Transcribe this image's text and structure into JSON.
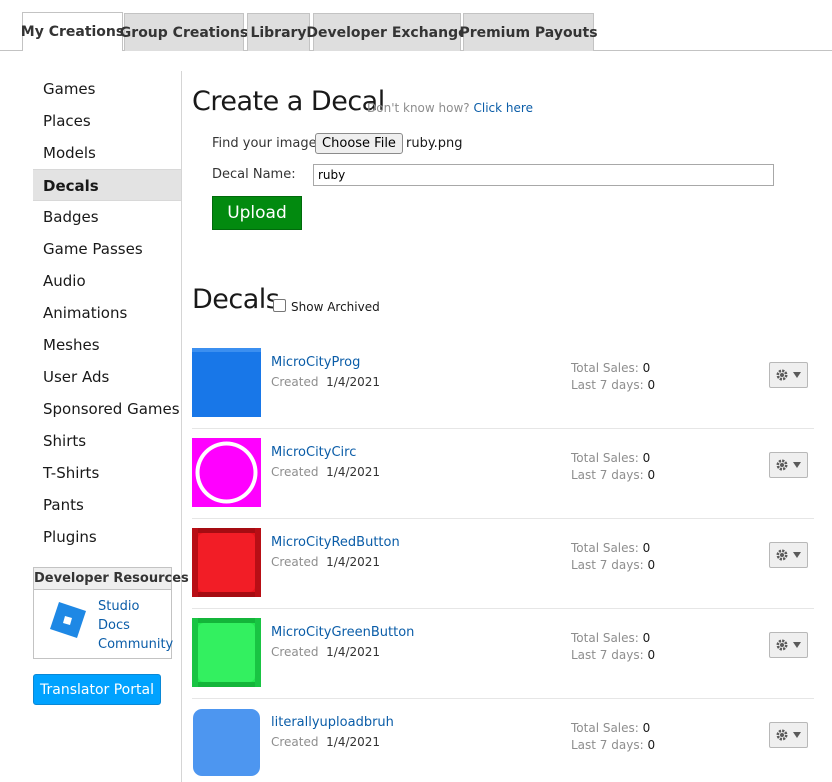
{
  "tabs": [
    {
      "label": "My Creations",
      "active": true
    },
    {
      "label": "Group Creations"
    },
    {
      "label": "Library"
    },
    {
      "label": "Developer Exchange"
    },
    {
      "label": "Premium Payouts"
    }
  ],
  "sidebar": {
    "items": [
      {
        "label": "Games"
      },
      {
        "label": "Places"
      },
      {
        "label": "Models"
      },
      {
        "label": "Decals",
        "active": true
      },
      {
        "label": "Badges"
      },
      {
        "label": "Game Passes"
      },
      {
        "label": "Audio"
      },
      {
        "label": "Animations"
      },
      {
        "label": "Meshes"
      },
      {
        "label": "User Ads"
      },
      {
        "label": "Sponsored Games"
      },
      {
        "label": "Shirts"
      },
      {
        "label": "T-Shirts"
      },
      {
        "label": "Pants"
      },
      {
        "label": "Plugins"
      }
    ],
    "dev_resources": {
      "title": "Developer Resources",
      "links": [
        "Studio",
        "Docs",
        "Community"
      ],
      "logo_icon": "roblox-studio-icon",
      "logo_color": "#1e88e5"
    },
    "translator_label": "Translator Portal"
  },
  "create": {
    "title": "Create a Decal",
    "help_text": "Don't know how?",
    "help_link": "Click here",
    "image_label": "Find your image:",
    "choose_label": "Choose File",
    "file_name": "ruby.png",
    "name_label": "Decal Name:",
    "name_value": "ruby",
    "upload_label": "Upload",
    "upload_color": "#028a0f"
  },
  "decals": {
    "title": "Decals",
    "archived_label": "Show Archived",
    "archived_checked": false,
    "created_label": "Created",
    "total_sales_label": "Total Sales:",
    "last7_label": "Last 7 days:",
    "items": [
      {
        "name": "MicroCityProg",
        "created": "1/4/2021",
        "total_sales": "0",
        "last7": "0",
        "thumb": "blue-square",
        "color": "#1877e8"
      },
      {
        "name": "MicroCityCirc",
        "created": "1/4/2021",
        "total_sales": "0",
        "last7": "0",
        "thumb": "magenta-circle",
        "color": "#ff00ff"
      },
      {
        "name": "MicroCityRedButton",
        "created": "1/4/2021",
        "total_sales": "0",
        "last7": "0",
        "thumb": "red-button",
        "color": "#e8121b"
      },
      {
        "name": "MicroCityGreenButton",
        "created": "1/4/2021",
        "total_sales": "0",
        "last7": "0",
        "thumb": "green-button",
        "color": "#22e84f"
      },
      {
        "name": "literallyuploadbruh",
        "created": "1/4/2021",
        "total_sales": "0",
        "last7": "0",
        "thumb": "blue-rounded-square",
        "color": "#4d96f0"
      }
    ]
  }
}
